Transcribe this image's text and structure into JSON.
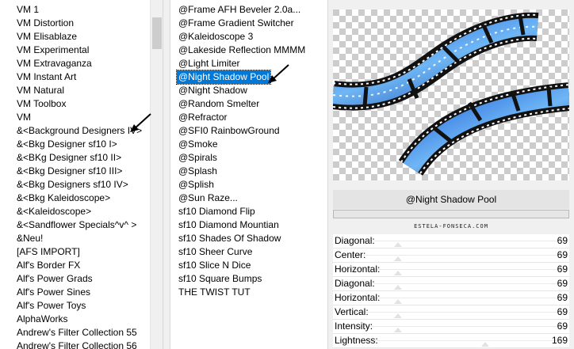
{
  "categories": {
    "items": [
      "VM 1",
      "VM Distortion",
      "VM Elisablaze",
      "VM Experimental",
      "VM Extravaganza",
      "VM Instant Art",
      "VM Natural",
      "VM Toolbox",
      "VM",
      "&<Background Designers IV>",
      "&<Bkg Designer sf10 I>",
      "&<BKg Designer sf10 II>",
      "&<Bkg Designer sf10 III>",
      "&<Bkg Designers sf10 IV>",
      "&<Bkg Kaleidoscope>",
      "&<Kaleidoscope>",
      "&<Sandflower Specials^v^ >",
      "&Neu!",
      "[AFS IMPORT]",
      "Alf's Border FX",
      "Alf's Power Grads",
      "Alf's Power Sines",
      "Alf's Power Toys",
      "AlphaWorks",
      "Andrew's Filter Collection 55",
      "Andrew's Filter Collection 56"
    ]
  },
  "filters": {
    "items": [
      "@Frame AFH Beveler 2.0a...",
      "@Frame Gradient Switcher",
      "@Kaleidoscope 3",
      "@Lakeside Reflection MMMM",
      "@Light Limiter",
      "@Night Shadow Pool",
      "@Night Shadow",
      "@Random Smelter",
      "@Refractor",
      "@SFI0 RainbowGround",
      "@Smoke",
      "@Spirals",
      "@Splash",
      "@Splish",
      "@Sun Raze...",
      "sf10 Diamond Flip",
      "sf10 Diamond Mountian",
      "sf10 Shades Of Shadow",
      "sf10 Sheer Curve",
      "sf10 Slice N Dice",
      "sf10 Square Bumps",
      "THE TWIST TUT"
    ],
    "selected": "@Night Shadow Pool"
  },
  "preview": {
    "filter_name": "@Night Shadow Pool",
    "watermark": "ESTELA-FONSECA.COM"
  },
  "params": [
    {
      "label": "Diagonal:",
      "value": "69"
    },
    {
      "label": "Center:",
      "value": "69"
    },
    {
      "label": "Horizontal:",
      "value": "69"
    },
    {
      "label": "Diagonal:",
      "value": "69"
    },
    {
      "label": "Horizontal:",
      "value": "69"
    },
    {
      "label": "Vertical:",
      "value": "69"
    },
    {
      "label": "Intensity:",
      "value": "69"
    },
    {
      "label": "Lightness:",
      "value": "169"
    }
  ],
  "colors": {
    "selection": "#0078d7",
    "arrow": "#000000",
    "film": "#111111"
  }
}
